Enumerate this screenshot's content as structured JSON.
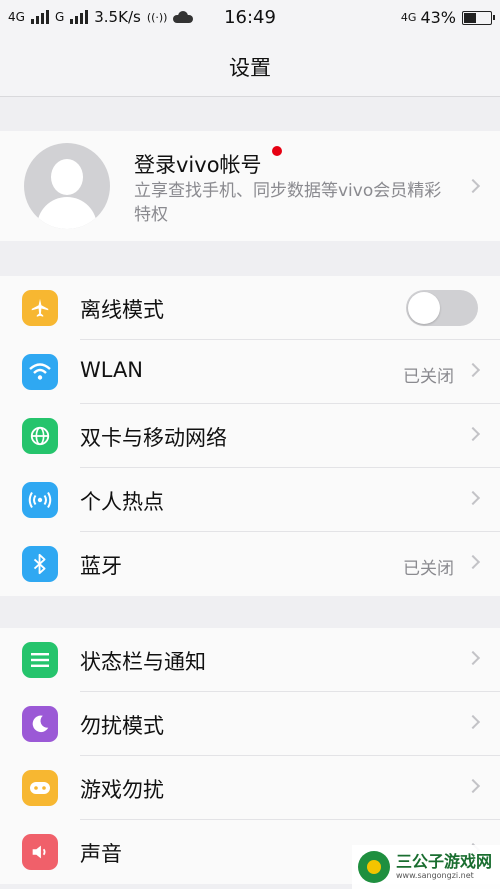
{
  "status_bar": {
    "network1": "4G",
    "network2": "G",
    "speed": "3.5K/s",
    "hotspot": "((·))",
    "time": "16:49",
    "network_right": "4G",
    "battery": "43%",
    "battery_level": 0.43
  },
  "header": {
    "title": "设置"
  },
  "account": {
    "title": "登录vivo帐号",
    "subtitle": "立享查找手机、同步数据等vivo会员精彩特权"
  },
  "group1": {
    "items": [
      {
        "label": "离线模式",
        "icon": "airplane-icon",
        "color": "#f7b731",
        "toggle_on": false
      },
      {
        "label": "WLAN",
        "icon": "wifi-icon",
        "color": "#2fa8f2",
        "value": "已关闭"
      },
      {
        "label": "双卡与移动网络",
        "icon": "globe-icon",
        "color": "#25c46c"
      },
      {
        "label": "个人热点",
        "icon": "hotspot-icon",
        "color": "#2fa8f2"
      },
      {
        "label": "蓝牙",
        "icon": "bluetooth-icon",
        "color": "#2fa8f2",
        "value": "已关闭"
      }
    ]
  },
  "group2": {
    "items": [
      {
        "label": "状态栏与通知",
        "icon": "notification-icon",
        "color": "#25c46c"
      },
      {
        "label": "勿扰模式",
        "icon": "moon-icon",
        "color": "#9b59d6"
      },
      {
        "label": "游戏勿扰",
        "icon": "gamepad-icon",
        "color": "#f7b731"
      },
      {
        "label": "声音",
        "icon": "speaker-icon",
        "color": "#f0606a"
      }
    ]
  },
  "watermark": {
    "name": "三公子游戏网",
    "url": "www.sangongzi.net"
  }
}
